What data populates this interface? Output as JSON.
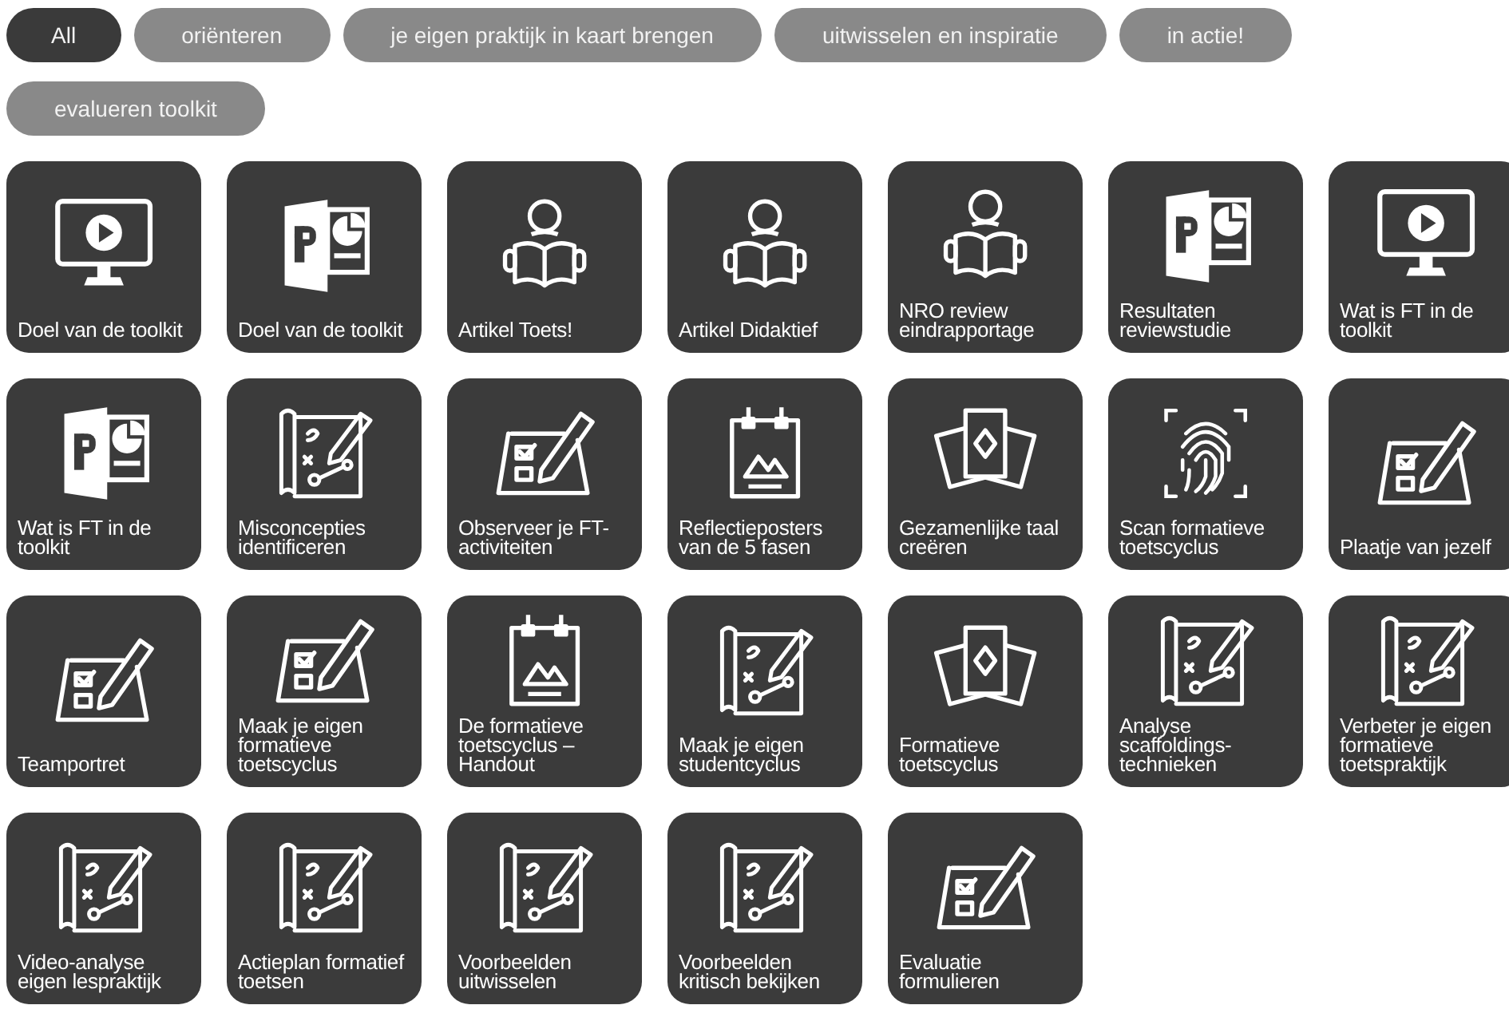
{
  "filters": [
    {
      "label": "All",
      "selected": true
    },
    {
      "label": "oriënteren",
      "selected": false
    },
    {
      "label": "je eigen praktijk in kaart brengen",
      "selected": false
    },
    {
      "label": "uitwisselen en inspiratie",
      "selected": false
    },
    {
      "label": "in actie!",
      "selected": false
    },
    {
      "label": "evalueren toolkit",
      "selected": false
    }
  ],
  "tiles": [
    {
      "label": "Doel van de toolkit",
      "kind": "video"
    },
    {
      "label": "Doel van de toolkit",
      "kind": "slides"
    },
    {
      "label": "Artikel Toets!",
      "kind": "reader"
    },
    {
      "label": "Artikel Didaktief",
      "kind": "reader"
    },
    {
      "label": "NRO review eindrapportage",
      "kind": "reader"
    },
    {
      "label": "Resultaten reviewstudie",
      "kind": "slides"
    },
    {
      "label": "Wat is FT in de toolkit",
      "kind": "video"
    },
    {
      "label": "Wat is FT in de toolkit",
      "kind": "slides"
    },
    {
      "label": "Misconcepties identificeren",
      "kind": "map"
    },
    {
      "label": "Observeer je FT-activiteiten",
      "kind": "checklist"
    },
    {
      "label": "Reflectieposters van de 5 fasen",
      "kind": "poster"
    },
    {
      "label": "Gezamenlijke taal creëren",
      "kind": "cards"
    },
    {
      "label": "Scan formatieve toetscyclus",
      "kind": "fingerprint"
    },
    {
      "label": "Plaatje van jezelf",
      "kind": "checklist"
    },
    {
      "label": "Teamportret",
      "kind": "checklist"
    },
    {
      "label": "Maak je eigen formatieve toetscyclus",
      "kind": "checklist"
    },
    {
      "label": "De formatieve toetscyclus – Handout",
      "kind": "poster"
    },
    {
      "label": "Maak je eigen studentcyclus",
      "kind": "map"
    },
    {
      "label": "Formatieve toetscyclus",
      "kind": "cards"
    },
    {
      "label": "Analyse scaffoldings-technieken",
      "kind": "map"
    },
    {
      "label": "Verbeter je eigen formatieve toetspraktijk",
      "kind": "map"
    },
    {
      "label": "Video-analyse eigen lespraktijk",
      "kind": "map"
    },
    {
      "label": "Actieplan formatief toetsen",
      "kind": "map"
    },
    {
      "label": "Voorbeelden uitwisselen",
      "kind": "map"
    },
    {
      "label": "Voorbeelden kritisch bekijken",
      "kind": "map"
    },
    {
      "label": "Evaluatie formulieren",
      "kind": "checklist"
    }
  ]
}
